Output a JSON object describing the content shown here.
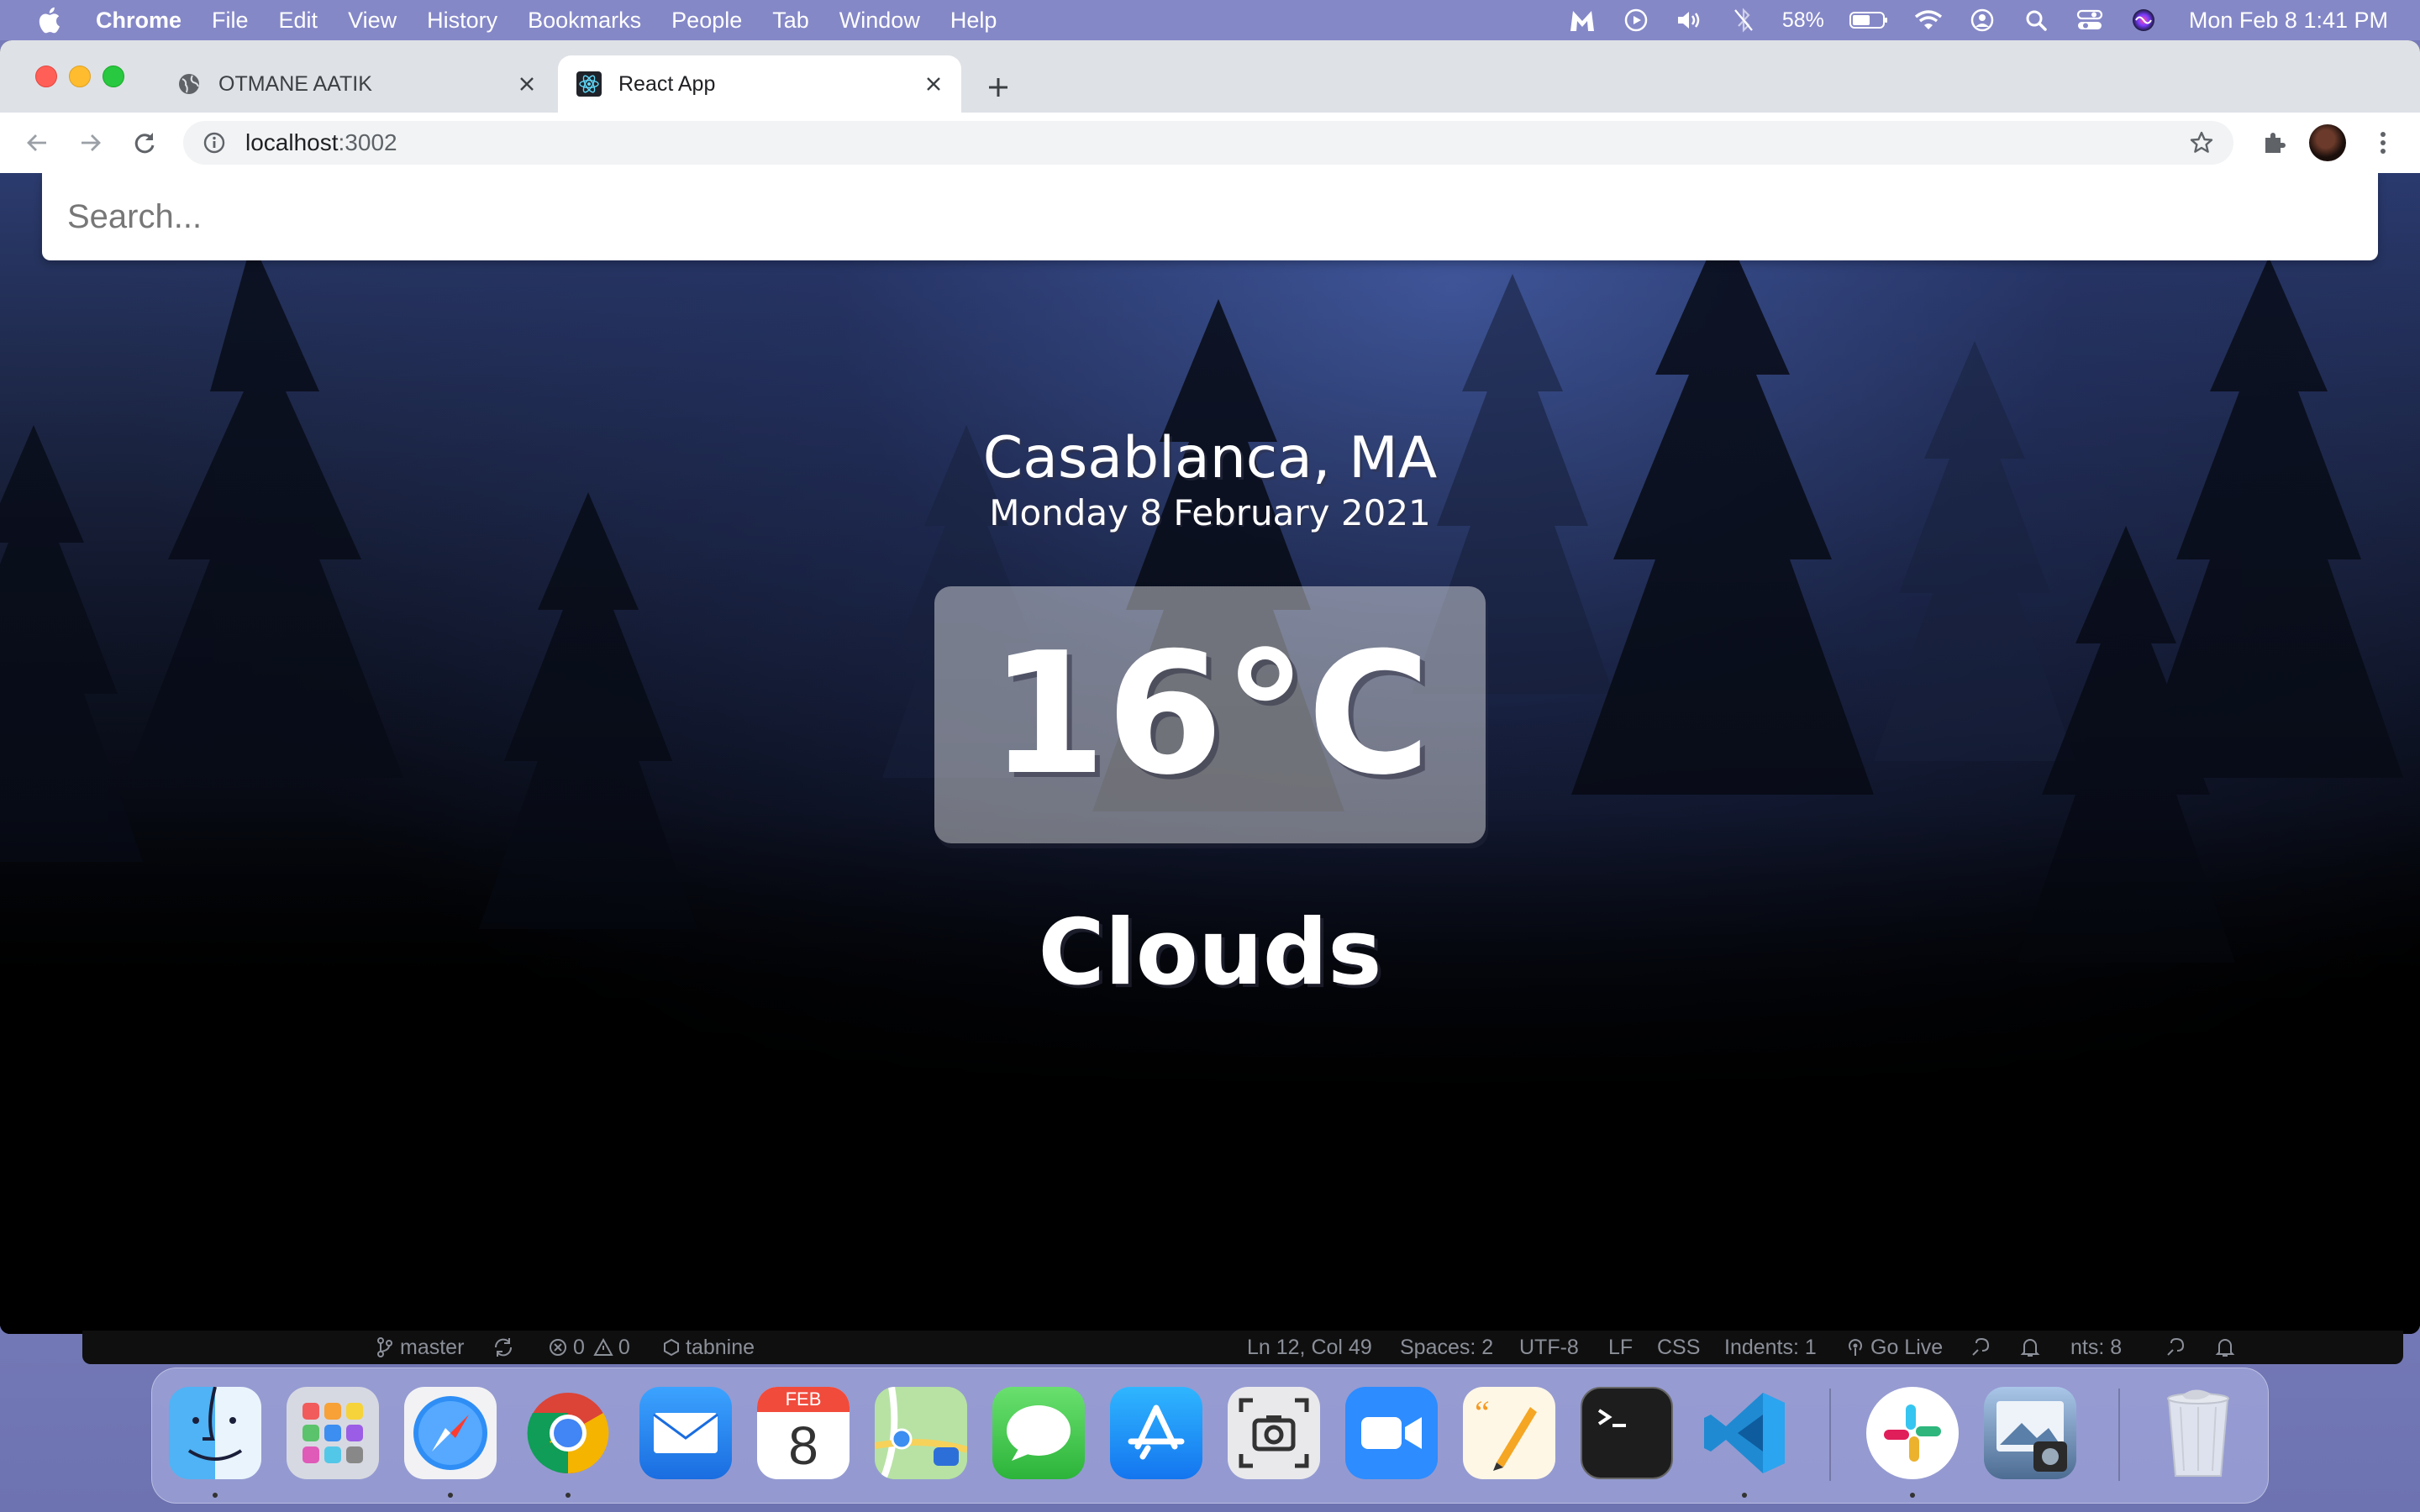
{
  "menubar": {
    "app_name": "Chrome",
    "items": [
      "File",
      "Edit",
      "View",
      "History",
      "Bookmarks",
      "People",
      "Tab",
      "Window",
      "Help"
    ],
    "battery": "58%",
    "clock": "Mon Feb 8  1:41 PM"
  },
  "tabs": [
    {
      "title": "OTMANE AATIK",
      "icon": "globe-icon",
      "active": false
    },
    {
      "title": "React App",
      "icon": "react-icon",
      "active": true
    }
  ],
  "omnibox": {
    "host": "localhost",
    "port": ":3002"
  },
  "page": {
    "search_placeholder": "Search...",
    "location": "Casablanca, MA",
    "date": "Monday 8 February 2021",
    "temperature": "16°C",
    "weather": "Clouds"
  },
  "vscode_status": {
    "branch": "master",
    "problems": "0",
    "warnings": "0",
    "tabnine": "tabnine",
    "cursor": "Ln 12, Col 49",
    "spaces": "Spaces: 2",
    "encoding": "UTF-8",
    "eol": "LF",
    "language": "CSS",
    "indents": "Indents: 1",
    "golive": "Go Live",
    "points": "nts: 8"
  },
  "dock": {
    "calendar_month": "FEB",
    "calendar_day": "8",
    "apps": [
      "Finder",
      "Launchpad",
      "Safari",
      "Chrome",
      "Mail",
      "Calendar",
      "Maps",
      "Messages",
      "App Store",
      "Screenshot",
      "Zoom",
      "Pages",
      "Terminal",
      "VS Code",
      "Slack",
      "Preview",
      "Trash"
    ]
  },
  "colors": {
    "menubar": "#8588c7",
    "tabstrip": "#dee1e6",
    "dock": "#b4b9eb"
  }
}
